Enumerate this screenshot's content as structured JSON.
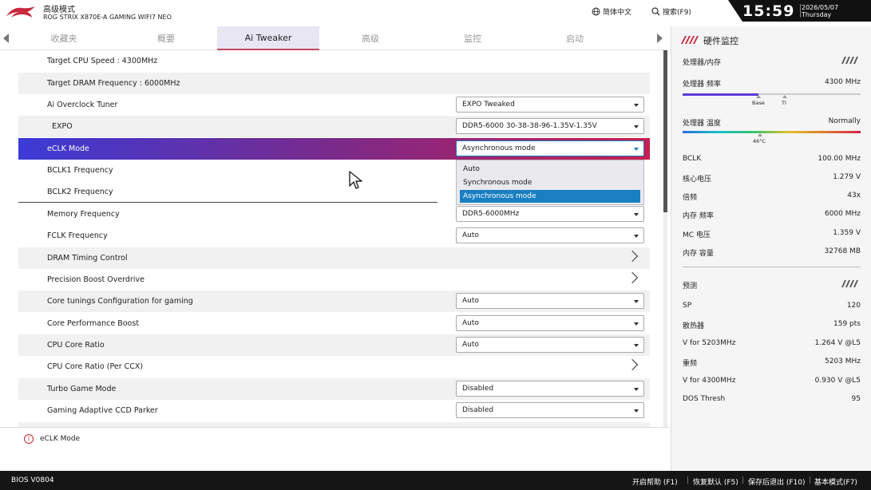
{
  "header": {
    "mode_title": "高级模式",
    "board_name": "ROG STRIX X870E-A GAMING WIFI7 NEO",
    "language": "简体中文",
    "search": "搜索(F9)",
    "time": "15:59",
    "date": "2026/05/07",
    "weekday": "Thursday"
  },
  "tabs": [
    "收藏夹",
    "概要",
    "Ai Tweaker",
    "高级",
    "监控",
    "启动"
  ],
  "active_tab": "Ai Tweaker",
  "settings": [
    {
      "label": "Target CPU Speed : 4300MHz"
    },
    {
      "label": "Target DRAM Frequency : 6000MHz"
    },
    {
      "label": "Ai Overclock Tuner",
      "value": "EXPO Tweaked"
    },
    {
      "label": "EXPO",
      "value": "DDR5-6000 30-38-38-96-1.35V-1.35V"
    },
    {
      "label": "eCLK Mode",
      "value": "Asynchronous mode"
    },
    {
      "label": "BCLK1 Frequency"
    },
    {
      "label": "BCLK2 Frequency"
    },
    {
      "label": "Memory Frequency",
      "value": "DDR5-6000MHz"
    },
    {
      "label": "FCLK Frequency",
      "value": "Auto"
    },
    {
      "label": "DRAM Timing Control"
    },
    {
      "label": "Precision Boost Overdrive"
    },
    {
      "label": "Core tunings Configuration for gaming",
      "value": "Auto"
    },
    {
      "label": "Core Performance Boost",
      "value": "Auto"
    },
    {
      "label": "CPU Core Ratio",
      "value": "Auto"
    },
    {
      "label": "CPU Core Ratio (Per CCX)"
    },
    {
      "label": "Turbo Game Mode",
      "value": "Disabled"
    },
    {
      "label": "Gaming Adaptive CCD Parker",
      "value": "Disabled"
    }
  ],
  "dropdown_options": [
    "Auto",
    "Synchronous mode",
    "Asynchronous mode"
  ],
  "dropdown_selected": "Asynchronous mode",
  "help_text": "eCLK Mode",
  "hardware_monitor": {
    "title": "硬件监控",
    "cpu_mem_section": "处理器/内存",
    "cpu_freq_label": "处理器 频率",
    "cpu_freq_value": "4300 MHz",
    "freq_marker_base": "Base",
    "freq_marker_ti": "TI",
    "cpu_temp_label": "处理器 温度",
    "cpu_temp_value": "Normally",
    "temp_marker": "46°C",
    "stats": [
      {
        "label": "BCLK",
        "value": "100.00 MHz"
      },
      {
        "label": "核心电压",
        "value": "1.279 V"
      },
      {
        "label": "倍频",
        "value": "43x"
      },
      {
        "label": "内存 频率",
        "value": "6000 MHz"
      },
      {
        "label": "MC 电压",
        "value": "1.359 V"
      },
      {
        "label": "内存 容量",
        "value": "32768 MB"
      }
    ],
    "predict_section": "预测",
    "predict": [
      {
        "label": "SP",
        "value": "120"
      },
      {
        "label": "散热器",
        "value": "159 pts"
      },
      {
        "label": "V for 5203MHz",
        "value": "1.264 V @L5"
      },
      {
        "label": "重频",
        "value": "5203 MHz"
      },
      {
        "label": "V for 4300MHz",
        "value": "0.930 V @L5"
      },
      {
        "label": "DOS Thresh",
        "value": "95"
      }
    ]
  },
  "footer": {
    "bios_version": "BIOS V0804",
    "help": "开启帮助 (F1)",
    "load_defaults": "恢复默认 (F5)",
    "save_exit": "保存后退出 (F10)",
    "basic_mode": "基本模式(F7)"
  },
  "colors": {
    "accent_red": "#c8283c",
    "selected_blue": "#1a7fc2",
    "gradient_start": "#3b3bd6",
    "gradient_end": "#c81e50"
  }
}
